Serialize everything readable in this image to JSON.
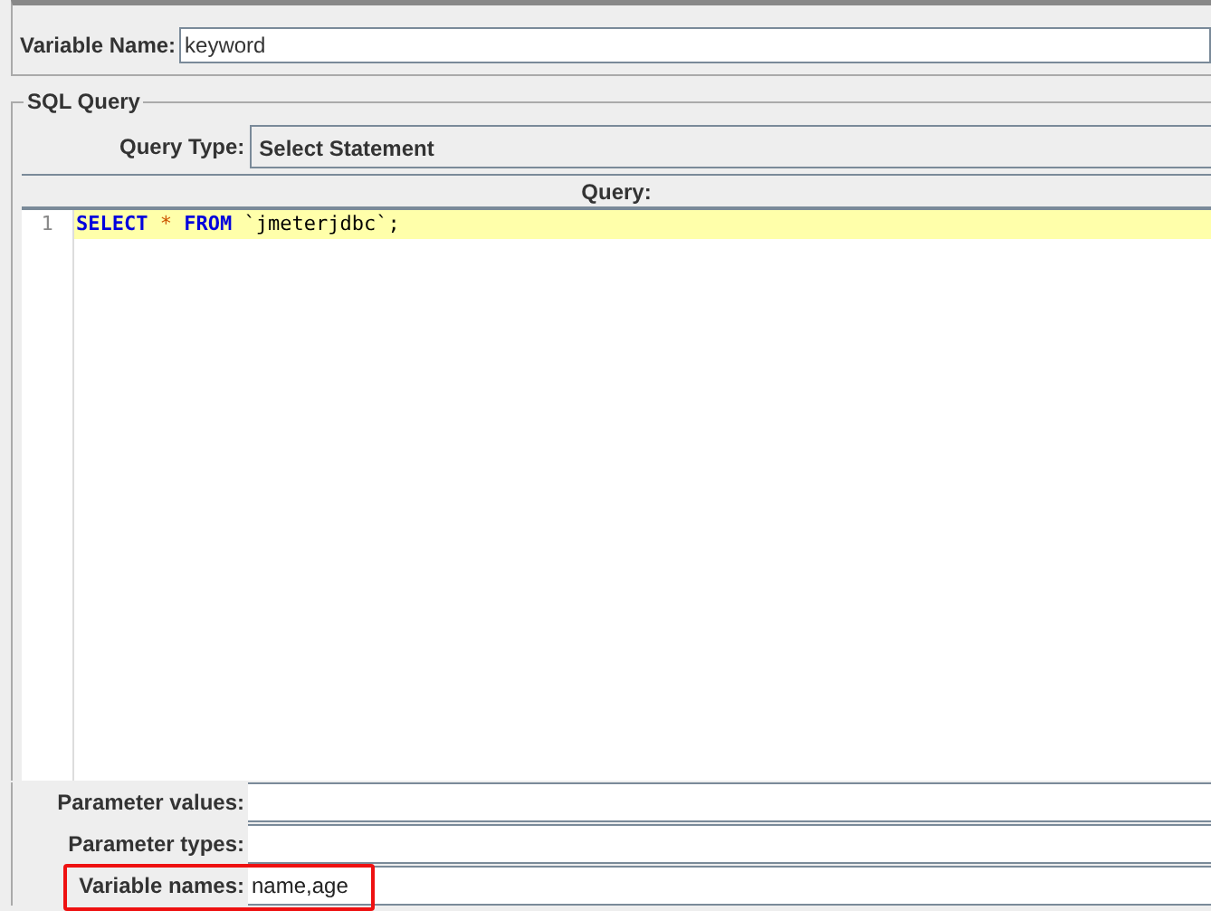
{
  "variable_name": {
    "label": "Variable Name:",
    "value": "keyword"
  },
  "sql_query": {
    "title": "SQL Query",
    "query_type": {
      "label": "Query Type:",
      "value": "Select Statement"
    },
    "query_label": "Query:",
    "editor": {
      "lines": [
        {
          "number": "1",
          "current": true,
          "tokens": [
            {
              "kind": "keyword",
              "text": "SELECT"
            },
            {
              "kind": "operator",
              "text": "*"
            },
            {
              "kind": "keyword",
              "text": "FROM"
            },
            {
              "kind": "plain",
              "text": "`jmeterjdbc`;"
            }
          ]
        }
      ]
    }
  },
  "parameters": [
    {
      "label": "Parameter values:",
      "highlighted": false
    },
    {
      "label": "Parameter types:",
      "highlighted": false
    },
    {
      "label": "Variable names:",
      "value": "name,age",
      "highlighted": true
    }
  ]
}
